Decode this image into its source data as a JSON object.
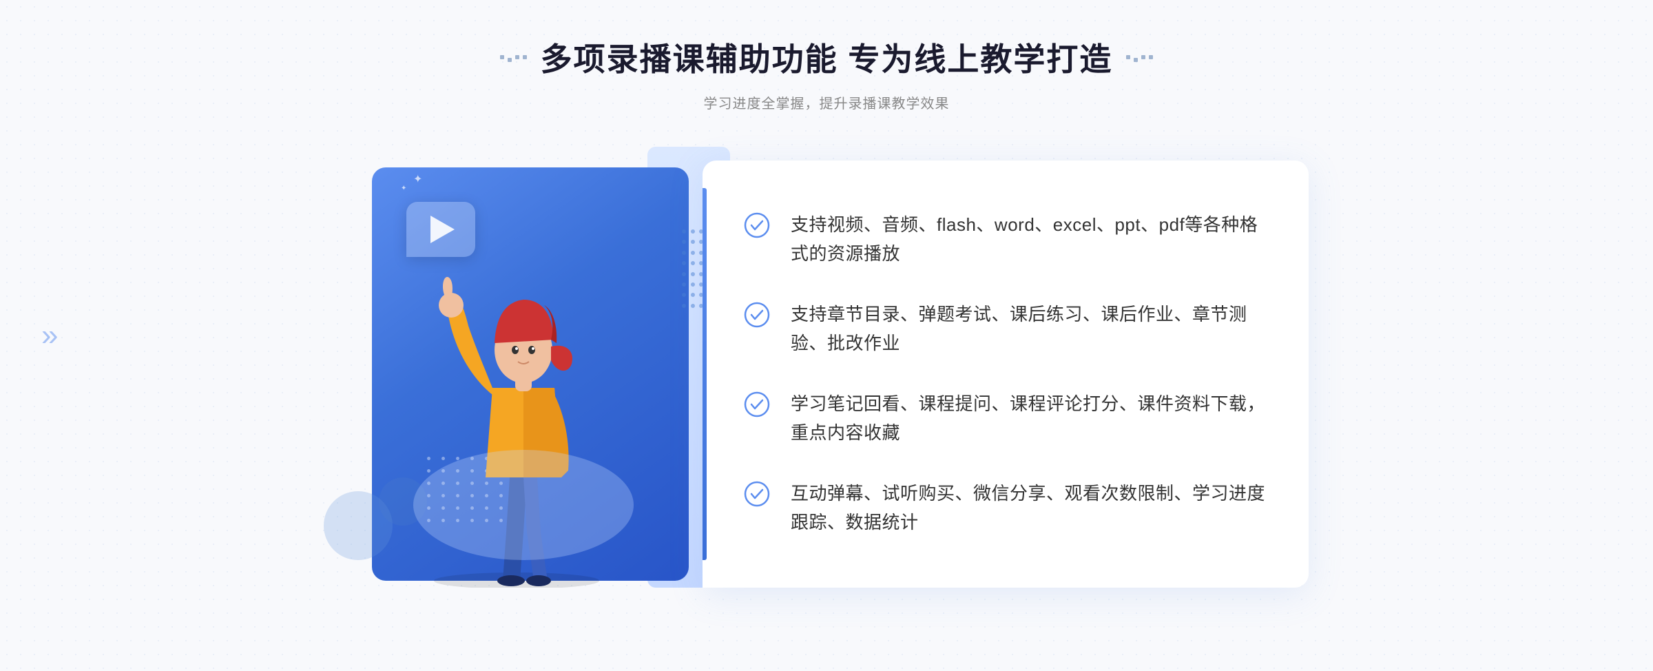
{
  "header": {
    "title": "多项录播课辅助功能 专为线上教学打造",
    "subtitle": "学习进度全掌握，提升录播课教学效果",
    "left_dots_label": "decorative dots left",
    "right_dots_label": "decorative dots right"
  },
  "features": [
    {
      "id": "feature-1",
      "text": "支持视频、音频、flash、word、excel、ppt、pdf等各种格式的资源播放",
      "icon": "check-circle"
    },
    {
      "id": "feature-2",
      "text": "支持章节目录、弹题考试、课后练习、课后作业、章节测验、批改作业",
      "icon": "check-circle"
    },
    {
      "id": "feature-3",
      "text": "学习笔记回看、课程提问、课程评论打分、课件资料下载，重点内容收藏",
      "icon": "check-circle"
    },
    {
      "id": "feature-4",
      "text": "互动弹幕、试听购买、微信分享、观看次数限制、学习进度跟踪、数据统计",
      "icon": "check-circle"
    }
  ],
  "illustration": {
    "play_button_label": "播放",
    "alt_text": "录播课辅助功能插图"
  },
  "left_arrow": "»"
}
